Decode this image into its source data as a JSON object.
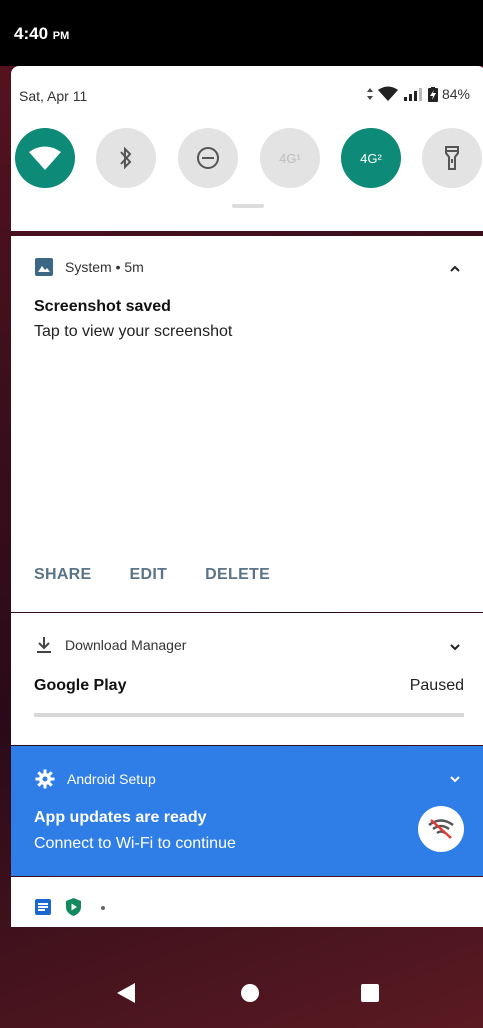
{
  "status_bar": {
    "time": "4:40",
    "ampm": "PM"
  },
  "quick_settings": {
    "date": "Sat, Apr 11",
    "battery": "84%",
    "tiles": [
      {
        "name": "wifi",
        "state": "on",
        "label": ""
      },
      {
        "name": "bluetooth",
        "state": "off",
        "label": ""
      },
      {
        "name": "do-not-disturb",
        "state": "off",
        "label": ""
      },
      {
        "name": "4g-sim1",
        "state": "off",
        "label": "4G¹"
      },
      {
        "name": "4g-sim2",
        "state": "on",
        "label": "4G²"
      },
      {
        "name": "flashlight",
        "state": "off",
        "label": ""
      }
    ]
  },
  "notifications": {
    "system": {
      "app": "System",
      "time": "5m",
      "title": "Screenshot saved",
      "text": "Tap to view your screenshot",
      "actions": {
        "share": "SHARE",
        "edit": "EDIT",
        "delete": "DELETE"
      }
    },
    "download": {
      "app": "Download Manager",
      "title": "Google Play",
      "status": "Paused",
      "progress": 0
    },
    "setup": {
      "app": "Android Setup",
      "title": "App updates are ready",
      "text": "Connect to Wi-Fi to continue",
      "color": "#2f7de6"
    }
  },
  "colors": {
    "accent": "#0e8a78",
    "action": "#5b7489"
  }
}
